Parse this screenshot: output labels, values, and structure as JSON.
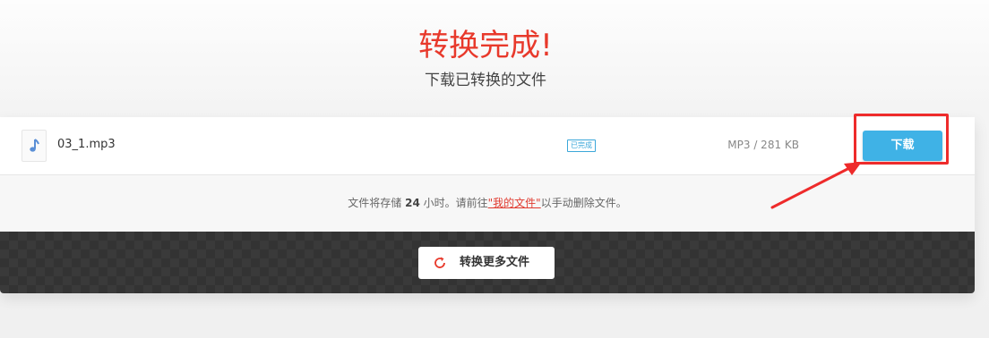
{
  "header": {
    "title": "转换完成!",
    "subtitle": "下载已转换的文件"
  },
  "file": {
    "icon": "music-note-icon",
    "name": "03_1.mp3",
    "status": "已完成",
    "size": "MP3 / 281 KB",
    "download_label": "下载"
  },
  "notice": {
    "prefix": "文件将存储",
    "hours": "24",
    "middle": "小时。请前往",
    "link": "\"我的文件\"",
    "suffix": "以手动删除文件。"
  },
  "actions": {
    "convert_more_label": "转换更多文件",
    "convert_more_icon": "refresh-icon"
  },
  "colors": {
    "accent_red": "#e8392b",
    "download_blue": "#3fb2e6",
    "annotation_red": "#ee2b2b"
  }
}
